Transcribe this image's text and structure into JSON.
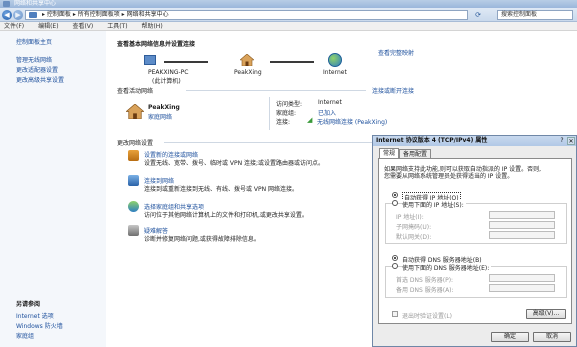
{
  "window": {
    "title": "网络和共享中心"
  },
  "address": {
    "breadcrumb": "▸ 控制面板 ▸ 所有控制面板项 ▸ 网络和共享中心",
    "search_placeholder": "搜索控制面板"
  },
  "menu": [
    "文件(F)",
    "编辑(E)",
    "查看(V)",
    "工具(T)",
    "帮助(H)"
  ],
  "sidebar": {
    "home": "控制面板主页",
    "links": [
      "管理无线网络",
      "更改适配器设置",
      "更改高级共享设置"
    ],
    "see_also_title": "另请参阅",
    "see_also": [
      "Internet 选项",
      "Windows 防火墙",
      "家庭组"
    ]
  },
  "main": {
    "heading": "查看基本网络信息并设置连接",
    "full_map": "查看完整映射",
    "map": {
      "pc_name": "PEAKXING-PC",
      "pc_sub": "(此计算机)",
      "network": "PeakXing",
      "internet": "Internet"
    },
    "active_title": "查看活动网络",
    "connect_link": "连接或断开连接",
    "network_name": "PeakXing",
    "network_type": "家庭网络",
    "access_type_label": "访问类型:",
    "access_type_value": "Internet",
    "homegroup_label": "家庭组:",
    "homegroup_value": "已加入",
    "connections_label": "连接:",
    "connections_value": "无线网络连接 (PeakXing)",
    "change_title": "更改网络设置",
    "tasks": [
      {
        "title": "设置新的连接或网络",
        "desc": "设置无线、宽带、拨号、临时或 VPN 连接;或设置路由器或访问点。"
      },
      {
        "title": "连接到网络",
        "desc": "连接到或重新连接到无线、有线、拨号或 VPN 网络连接。"
      },
      {
        "title": "选择家庭组和共享选项",
        "desc": "访问位于其他网络计算机上的文件和打印机,或更改共享设置。"
      },
      {
        "title": "疑难解答",
        "desc": "诊断并修复网络问题,或获得故障排除信息。"
      }
    ]
  },
  "dialog": {
    "title": "Internet 协议版本 4 (TCP/IPv4) 属性",
    "help": "?",
    "close": "✕",
    "tabs": [
      "常规",
      "备用配置"
    ],
    "desc_line1": "如果网络支持此功能,则可以获取自动指派的 IP 设置。否则,",
    "desc_line2": "您需要从网络系统管理员处获得适当的 IP 设置。",
    "auto_ip": "自动获得 IP 地址(O)",
    "manual_ip": "使用下面的 IP 地址(S):",
    "ip_label": "IP 地址(I):",
    "mask_label": "子网掩码(U):",
    "gateway_label": "默认网关(D):",
    "auto_dns": "自动获得 DNS 服务器地址(B)",
    "manual_dns": "使用下面的 DNS 服务器地址(E):",
    "pref_dns_label": "首选 DNS 服务器(P):",
    "alt_dns_label": "备用 DNS 服务器(A):",
    "validate": "退出时验证设置(L)",
    "advanced": "高级(V)...",
    "ok": "确定",
    "cancel": "取消"
  }
}
